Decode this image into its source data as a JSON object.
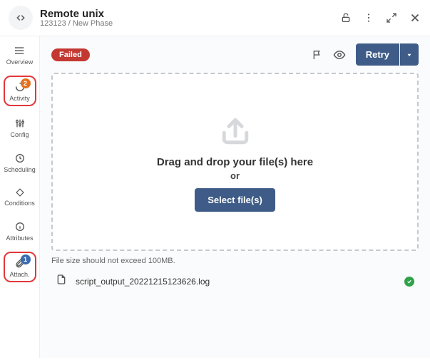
{
  "header": {
    "title": "Remote unix",
    "breadcrumb": "123123 / New Phase"
  },
  "sidebar": {
    "items": [
      {
        "label": "Overview"
      },
      {
        "label": "Activity",
        "badge": "2"
      },
      {
        "label": "Config"
      },
      {
        "label": "Scheduling"
      },
      {
        "label": "Conditions"
      },
      {
        "label": "Attributes"
      },
      {
        "label": "Attach.",
        "badge": "1"
      }
    ]
  },
  "main": {
    "status": "Failed",
    "retry_label": "Retry",
    "dropzone": {
      "line1": "Drag and drop your file(s) here",
      "or": "or",
      "button": "Select file(s)"
    },
    "hint": "File size should not exceed 100MB.",
    "files": [
      {
        "name": "script_output_20221215123626.log"
      }
    ]
  }
}
